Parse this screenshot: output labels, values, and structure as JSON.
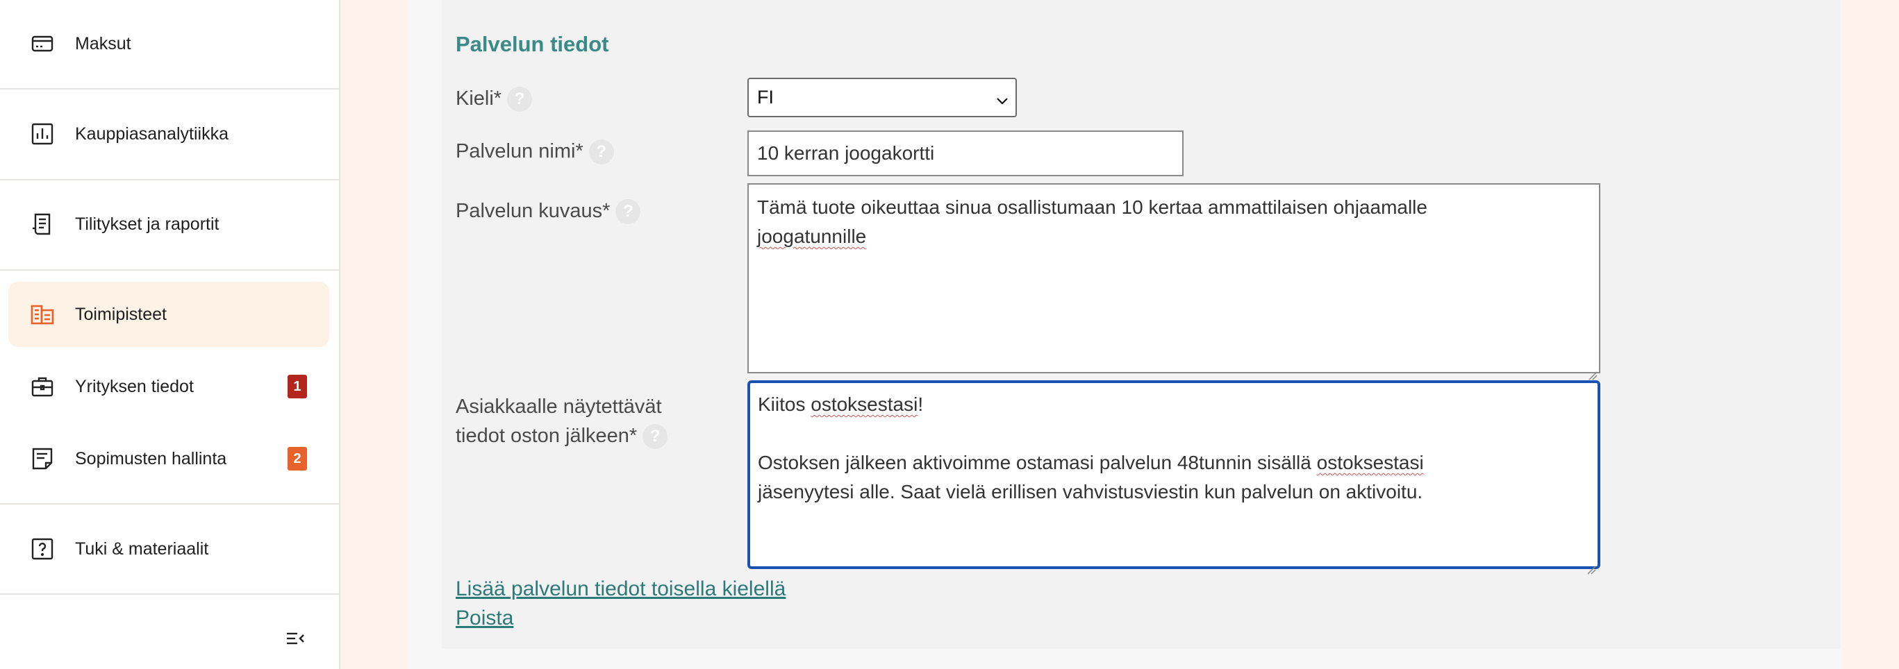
{
  "sidebar": {
    "items": [
      {
        "label": "Maksut",
        "icon": "credit-card-icon",
        "badge": ""
      },
      {
        "label": "Kauppiasanalytiikka",
        "icon": "bar-chart-icon",
        "badge": ""
      },
      {
        "label": "Tilitykset ja raportit",
        "icon": "receipt-icon",
        "badge": ""
      },
      {
        "label": "Toimipisteet",
        "icon": "storefront-icon",
        "badge": ""
      },
      {
        "label": "Yrityksen tiedot",
        "icon": "briefcase-icon",
        "badge": "1"
      },
      {
        "label": "Sopimusten hallinta",
        "icon": "document-icon",
        "badge": "2"
      },
      {
        "label": "Tuki & materiaalit",
        "icon": "help-square-icon",
        "badge": ""
      }
    ],
    "collapse_icon": "collapse-menu-icon"
  },
  "form": {
    "section_title": "Palvelun tiedot",
    "language_label": "Kieli*",
    "language_value": "FI",
    "name_label": "Palvelun nimi*",
    "name_value": "10 kerran joogakortti",
    "description_label": "Palvelun kuvaus*",
    "description_line1": "Tämä tuote oikeuttaa sinua osallistumaan 10 kertaa ammattilaisen ohjaamalle",
    "description_line2": "joogatunnille",
    "after_purchase_label_line1": "Asiakkaalle näytettävät",
    "after_purchase_label_line2": "tiedot oston jälkeen*",
    "after_purchase_line1_a": "Kiitos ",
    "after_purchase_line1_b": "ostoksestasi",
    "after_purchase_line1_c": "!",
    "after_purchase_line3_a": "Ostoksen jälkeen aktivoimme ostamasi palvelun 48tunnin sisällä ",
    "after_purchase_line3_b": "ostoksestasi",
    "after_purchase_line4": "jäsenyytesi alle. Saat vielä erillisen vahvistusviestin kun palvelun on aktivoitu.",
    "help_glyph": "?",
    "add_language_link": "Lisää palvelun tiedot toisella kielellä",
    "remove_link": "Poista"
  },
  "colors": {
    "accent_teal": "#3a8a87",
    "active_orange": "#e8622c",
    "badge_red": "#b3261e",
    "badge_orange": "#e8622c",
    "focus_blue": "#1a52b3"
  }
}
